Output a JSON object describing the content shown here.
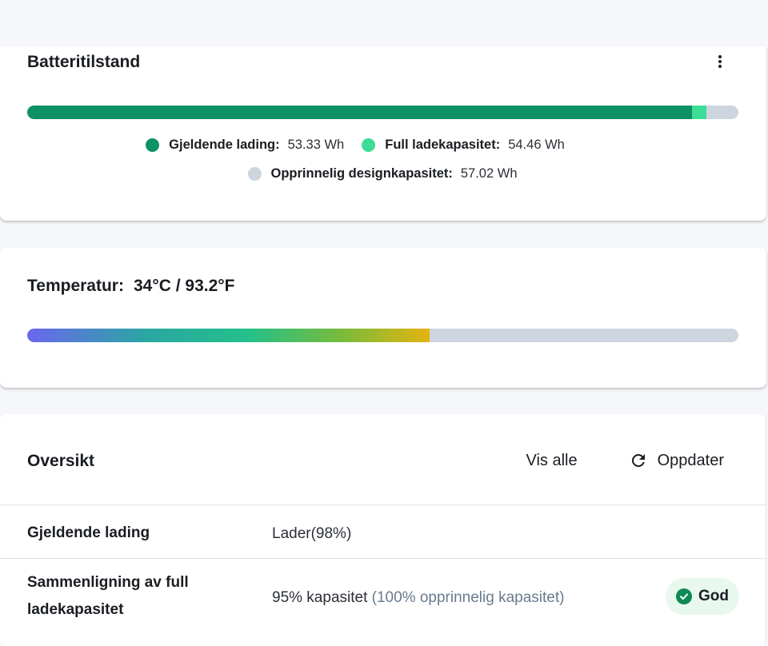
{
  "battery": {
    "title": "Batteritilstand",
    "menu_icon": "more-vert-icon",
    "current_charge_fraction": 0.9353,
    "full_capacity_fraction": 0.9551,
    "legend": {
      "current": {
        "label": "Gjeldende lading:",
        "value": "53.33 Wh",
        "color": "#0e9163"
      },
      "full": {
        "label": "Full ladekapasitet:",
        "value": "54.46 Wh",
        "color": "#3ddc97"
      },
      "design": {
        "label": "Opprinnelig designkapasitet:",
        "value": "57.02 Wh",
        "color": "#cdd5df"
      }
    }
  },
  "temperature": {
    "label": "Temperatur:",
    "value": "34°C / 93.2°F",
    "fill_fraction": 0.566
  },
  "overview": {
    "title": "Oversikt",
    "view_all": "Vis alle",
    "refresh": "Oppdater",
    "refresh_icon": "refresh-icon",
    "rows": [
      {
        "label": "Gjeldende lading",
        "value": "Lader(98%)"
      },
      {
        "label": "Sammenligning av full ladekapasitet",
        "value": "95% kapasitet",
        "note": "(100% opprinnelig kapasitet)",
        "badge": "God",
        "badge_icon": "check-circle-icon"
      }
    ]
  }
}
